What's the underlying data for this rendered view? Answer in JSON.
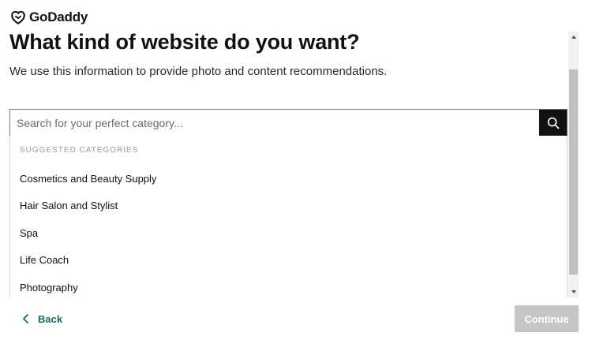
{
  "brand": {
    "name": "GoDaddy",
    "logo_icon": "godaddy-logo-icon"
  },
  "header": {
    "title": "What kind of website do you want?",
    "subtitle": "We use this information to provide photo and content recommendations."
  },
  "search": {
    "placeholder": "Search for your perfect category...",
    "value": "",
    "button_icon": "search-icon"
  },
  "suggestions": {
    "heading": "SUGGESTED CATEGORIES",
    "items": [
      {
        "label": "Cosmetics and Beauty Supply"
      },
      {
        "label": "Hair Salon and Stylist"
      },
      {
        "label": "Spa"
      },
      {
        "label": "Life Coach"
      },
      {
        "label": "Photography"
      }
    ]
  },
  "footer": {
    "back_label": "Back",
    "back_icon": "chevron-left-icon",
    "continue_label": "Continue"
  },
  "colors": {
    "accent": "#1a6c69",
    "search_button_bg": "#111111",
    "continue_disabled_bg": "#c6c6c6",
    "text": "#111111"
  }
}
